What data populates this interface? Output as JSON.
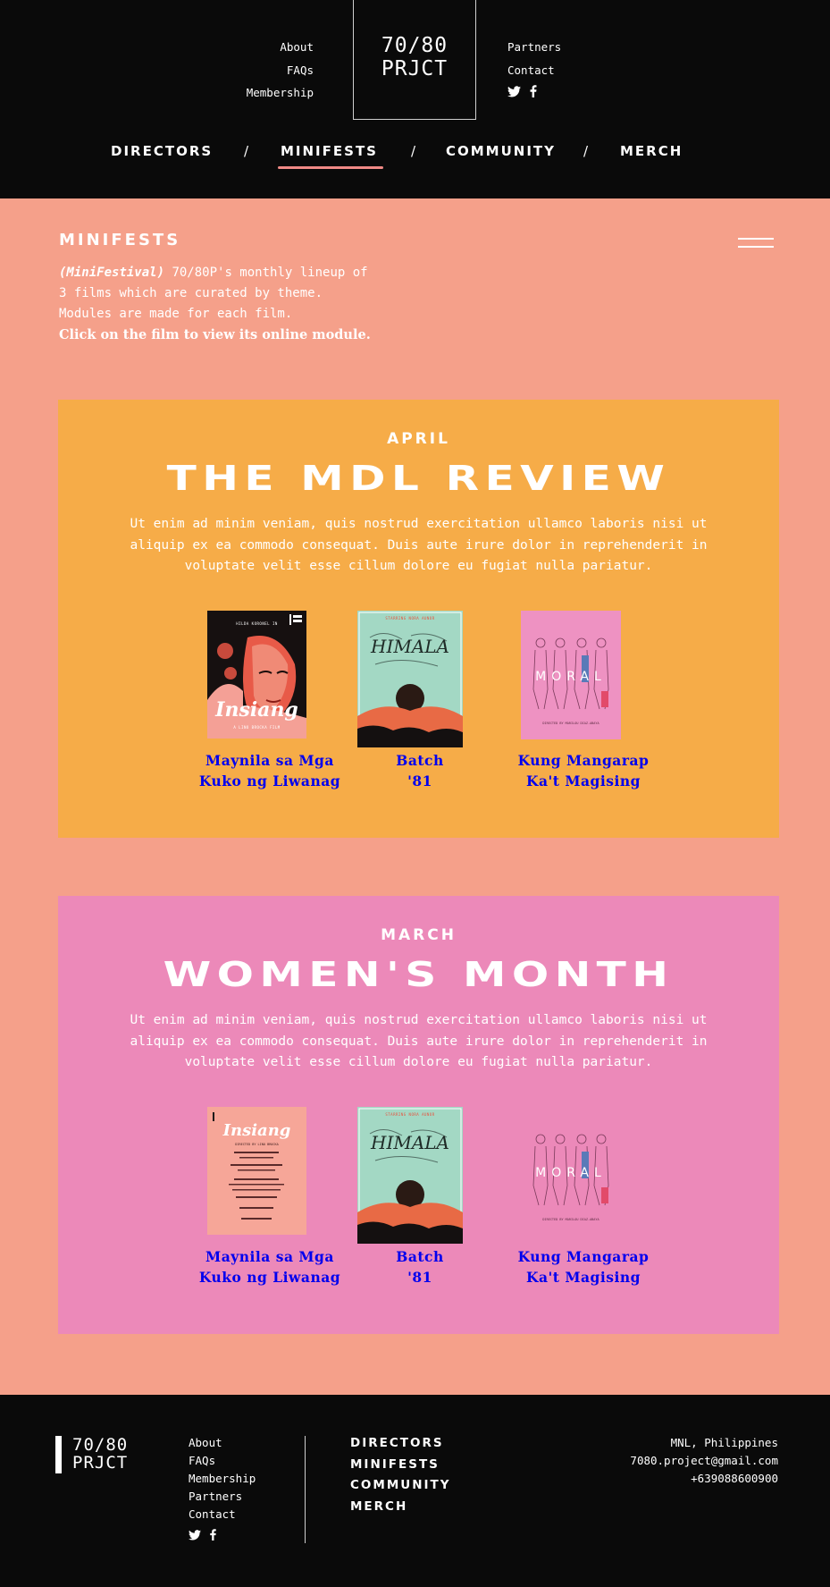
{
  "header": {
    "left_links": [
      "About",
      "FAQs",
      "Membership"
    ],
    "right_links": [
      "Partners",
      "Contact"
    ],
    "logo_line1": "70/80",
    "logo_line2": "PRJCT",
    "social_icons": [
      "twitter-icon",
      "facebook-icon"
    ],
    "nav": [
      {
        "label": "DIRECTORS",
        "active": false
      },
      {
        "label": "MINIFESTS",
        "active": true
      },
      {
        "label": "COMMUNITY",
        "active": false
      },
      {
        "label": "MERCH",
        "active": false
      }
    ],
    "nav_separator": "/",
    "accent_color": "#f08a86"
  },
  "page": {
    "title": "MINIFESTS",
    "intro_em": "(MiniFestival)",
    "intro_rest_1": " 70/80P's monthly lineup of",
    "intro_line2": "3 films which are curated by theme.",
    "intro_line3": "Modules are made for each film.",
    "intro_cta": "Click on the film to view its online module.",
    "background": "#f5a08a"
  },
  "sections": [
    {
      "month": "APRIL",
      "theme": "THE MDL REVIEW",
      "description": "Ut enim ad minim veniam, quis nostrud exercitation ullamco laboris nisi ut aliquip ex ea commodo consequat. Duis aute irure dolor in reprehenderit in voluptate velit esse cillum dolore eu fugiat nulla pariatur.",
      "background": "#f6ac48",
      "films": [
        {
          "title_line1": "Maynila sa Mga",
          "title_line2": "Kuko ng Liwanag",
          "poster_title": "Insiang",
          "poster_tagline": "A LINO BROCKA FILM",
          "poster_credit": "HILDA KORONEL IN"
        },
        {
          "title_line1": "Batch",
          "title_line2": "'81",
          "poster_title": "HIMALA",
          "poster_credit": "STARRING NORA AUNOR"
        },
        {
          "title_line1": "Kung Mangarap",
          "title_line2": "Ka't Magising",
          "poster_title": "MORAL",
          "poster_credit": "DIRECTED BY MARILOU DIAZ-ABAYA"
        }
      ]
    },
    {
      "month": "MARCH",
      "theme": "WOMEN'S MONTH",
      "description": "Ut enim ad minim veniam, quis nostrud exercitation ullamco laboris nisi ut aliquip ex ea commodo consequat. Duis aute irure dolor in reprehenderit in voluptate velit esse cillum dolore eu fugiat nulla pariatur.",
      "background": "#ec89b9",
      "films": [
        {
          "title_line1": "Maynila sa Mga",
          "title_line2": "Kuko ng Liwanag",
          "poster_title": "Insiang",
          "poster_credit": "DIRECTED BY LINO BROCKA"
        },
        {
          "title_line1": "Batch",
          "title_line2": "'81",
          "poster_title": "HIMALA",
          "poster_credit": "STARRING NORA AUNOR"
        },
        {
          "title_line1": "Kung Mangarap",
          "title_line2": "Ka't Magising",
          "poster_title": "MORAL",
          "poster_credit": "DIRECTED BY MARILOU DIAZ-ABAYA"
        }
      ]
    }
  ],
  "footer": {
    "logo_line1": "70/80",
    "logo_line2": "PRJCT",
    "links": [
      "About",
      "FAQs",
      "Membership",
      "Partners",
      "Contact"
    ],
    "nav": [
      "DIRECTORS",
      "MINIFESTS",
      "COMMUNITY",
      "MERCH"
    ],
    "location": "MNL, Philippines",
    "email": "7080.project@gmail.com",
    "phone": "+639088600900"
  }
}
